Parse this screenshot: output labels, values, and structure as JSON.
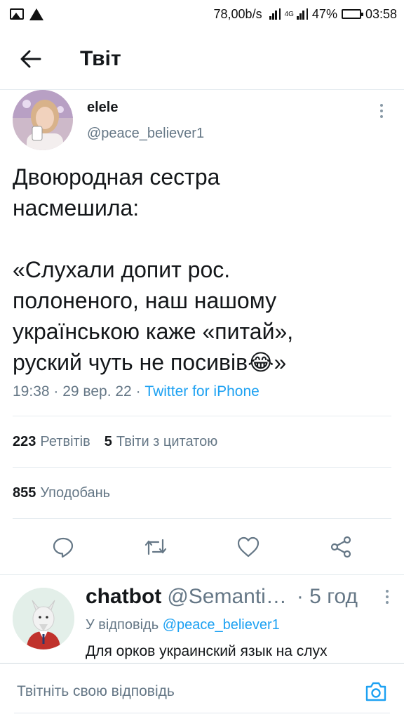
{
  "status_bar": {
    "net_speed": "78,00b/s",
    "network_type": "4G",
    "battery": "47%",
    "battery_level": 0.47,
    "time": "03:58"
  },
  "header": {
    "title": "Твіт"
  },
  "tweet": {
    "author_name": "elele",
    "author_handle": "@peace_believer1",
    "text": "Двоюродная сестра\nнасмешила:\n\n«Слухали допит рос.\nполоненого, наш нашому\nукраїнською каже «питай»,\nруский чуть не посивів😂»",
    "time": "19:38",
    "date": "29 вер. 22",
    "source": "Twitter for iPhone",
    "retweets_count": "223",
    "retweets_label": "Ретвітів",
    "quotes_count": "5",
    "quotes_label": "Твіти з цитатою",
    "likes_count": "855",
    "likes_label": "Уподобань"
  },
  "reply": {
    "name": "chatbot",
    "handle": "@Semanti…",
    "time": "5 год",
    "reply_to_label": "У відповідь",
    "reply_to_handle": "@peace_believer1",
    "text": "Для орков украинский язык на слух"
  },
  "composer": {
    "placeholder": "Твітніть свою відповідь"
  },
  "colors": {
    "accent": "#1da1f2",
    "secondary_text": "#657786",
    "primary_text": "#14171a",
    "divider": "#e6ecf0"
  },
  "icons": {
    "back": "arrow-left-icon",
    "reply": "speech-bubble-icon",
    "retweet": "retweet-arrows-icon",
    "like": "heart-icon",
    "share": "share-nodes-icon",
    "camera": "camera-icon",
    "more": "vertical-dots-icon"
  }
}
